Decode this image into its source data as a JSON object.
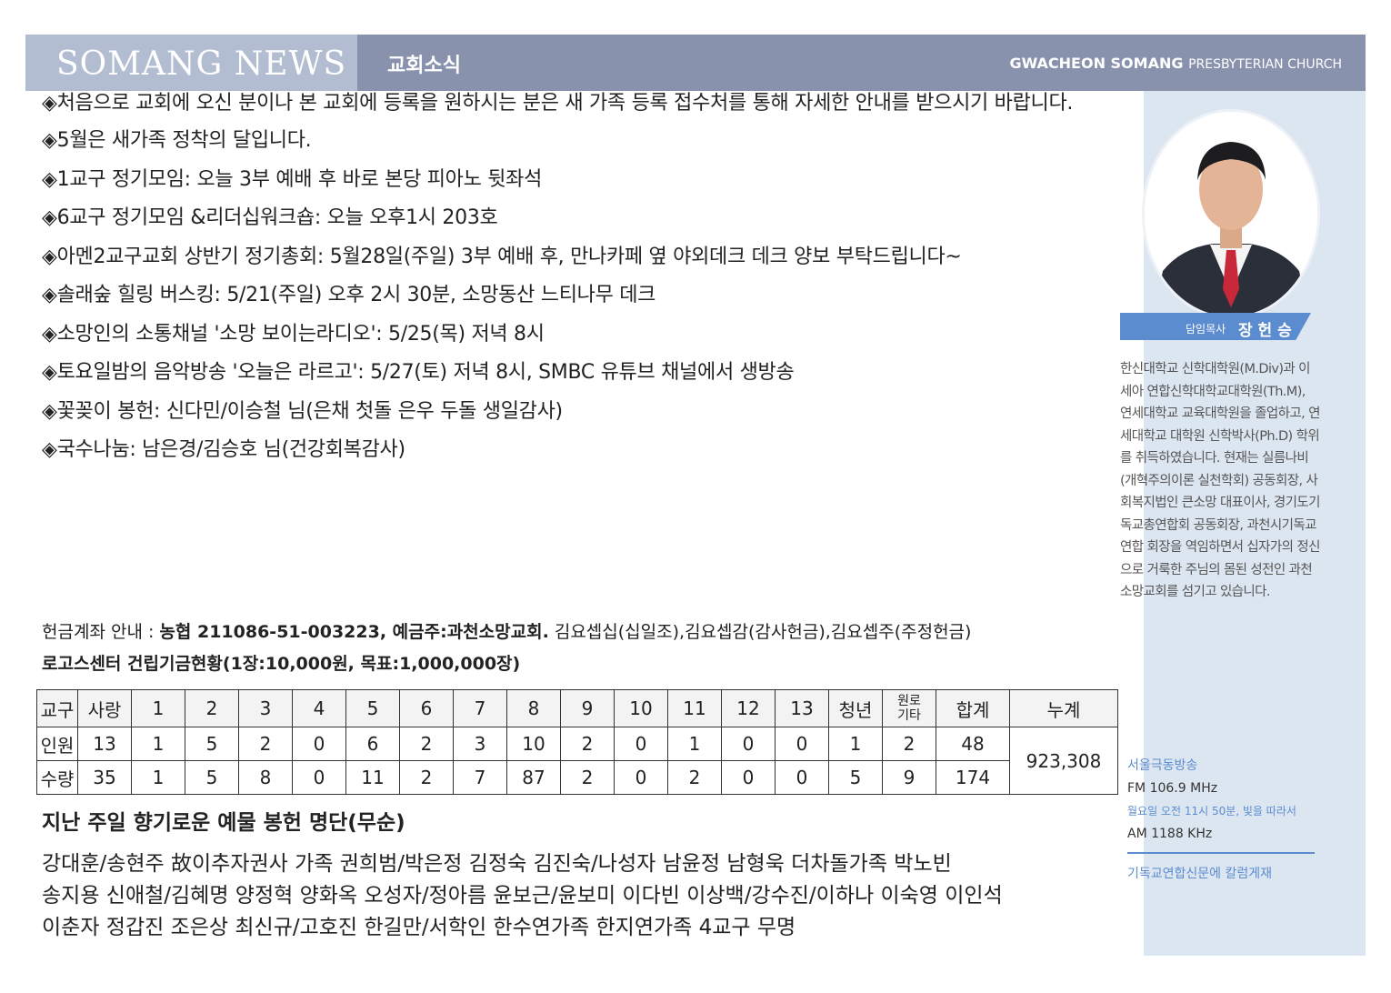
{
  "header": {
    "logo": "SOMANG NEWS",
    "section_title": "교회소식",
    "church_bold": "GWACHEON SOMANG",
    "church_small": "PRESBYTERIAN CHURCH"
  },
  "notices": [
    "◈처음으로 교회에 오신 분이나 본 교회에 등록을 원하시는 분은 새 가족 등록 접수처를 통해 자세한 안내를 받으시기 바랍니다.",
    "◈5월은 새가족 정착의 달입니다.",
    "◈1교구 정기모임: 오늘 3부 예배 후 바로 본당 피아노 뒷좌석",
    "◈6교구 정기모임 &리더십워크숍: 오늘 오후1시 203호",
    "◈아멘2교구교회 상반기 정기총회: 5월28일(주일) 3부 예배 후, 만나카페 옆 야외데크 데크 양보 부탁드립니다~",
    "◈솔래숲 힐링 버스킹: 5/21(주일) 오후 2시 30분, 소망동산 느티나무 데크",
    "◈소망인의 소통채널 '소망 보이는라디오': 5/25(목) 저녁 8시",
    "◈토요일밤의 음악방송 '오늘은 라르고': 5/27(토) 저녁 8시, SMBC 유튜브 채널에서 생방송",
    "◈꽃꽂이 봉헌: 신다민/이승철 님(은채 첫돌 은우 두돌 생일감사)",
    "◈국수나눔: 남은경/김승호 님(건강회복감사)"
  ],
  "account": {
    "label": "헌금계좌 안내 : ",
    "bank": "농협 211086-51-003223, 예금주:과천소망교회.",
    "detail": " 김요셉십(십일조),김요셉감(감사헌금),김요셉주(주정헌금)"
  },
  "fund_title": "로고스센터 건립기금현황(1장:10,000원, 목표:1,000,000장)",
  "fund_table": {
    "headers": [
      "교구",
      "사랑",
      "1",
      "2",
      "3",
      "4",
      "5",
      "6",
      "7",
      "8",
      "9",
      "10",
      "11",
      "12",
      "13",
      "청년",
      "원로",
      "기타",
      "합계",
      "누계"
    ],
    "row_people": [
      "인원",
      "13",
      "1",
      "5",
      "2",
      "0",
      "6",
      "2",
      "3",
      "10",
      "2",
      "0",
      "1",
      "0",
      "0",
      "1",
      "2",
      "48"
    ],
    "row_quantity": [
      "수량",
      "35",
      "1",
      "5",
      "8",
      "0",
      "11",
      "2",
      "7",
      "87",
      "2",
      "0",
      "2",
      "0",
      "0",
      "5",
      "9",
      "174"
    ],
    "cumulative": "923,308"
  },
  "donor_title": "지난 주일 향기로운 예물 봉헌 명단(무순)",
  "donor_lines": [
    "강대훈/송현주 故이추자권사 가족 권희범/박은정 김정숙 김진숙/나성자 남윤정 남형욱 더차돌가족 박노빈",
    "송지용 신애철/김혜명 양정혁 양화옥 오성자/정아름 윤보근/윤보미 이다빈 이상백/강수진/이하나 이숙영 이인석",
    "이춘자 정갑진 조은상 최신규/고호진 한길만/서학인 한수연가족 한지연가족 4교구 무명"
  ],
  "pastor": {
    "title": "담임목사",
    "name": "장 헌 승",
    "bio": "한신대학교 신학대학원(M.Div)과 이세아 연합신학대학교대학원(Th.M), 연세대학교 교육대학원을 졸업하고, 연세대학교 대학원 신학박사(Ph.D) 학위를 취득하였습니다. 현재는 실름나비(개혁주의이론 실천학회) 공동회장, 사회복지법인 큰소망 대표이사, 경기도기독교총연합회 공동회장, 과천시기독교연합 회장을 역임하면서 십자가의 정신으로 거룩한 주님의 몸된 성전인 과천소망교회를 섬기고 있습니다."
  },
  "radio": {
    "station": "서울극동방송",
    "fm": "FM 106.9 MHz",
    "time": "월요일 오전 11시 50분, 빛을 따라서",
    "am": "AM 1188 KHz",
    "newspaper": "기독교연합신문에 칼럼게재"
  },
  "colors": {
    "header_bg": "#8892ad",
    "logo_bg": "#b3bdd2",
    "sidebar_bg": "#dce6f1",
    "accent": "#5b8cd0"
  }
}
